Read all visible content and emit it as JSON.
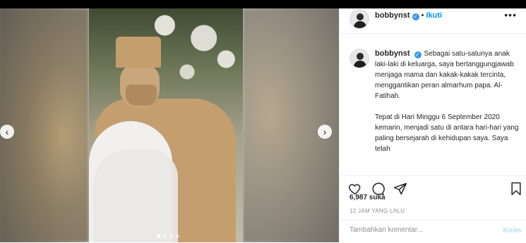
{
  "media": {
    "slide_count": 4,
    "active_slide": 1,
    "prev_icon": "chevron-left-icon",
    "next_icon": "chevron-right-icon"
  },
  "header": {
    "username": "bobbynst",
    "separator": "•",
    "follow_label": "Ikuti",
    "more_icon": "more-options-icon"
  },
  "caption": {
    "username": "bobbynst",
    "paragraph1": "Sebagai satu-satunya anak laki-laki di keluarga, saya bertanggungjawab menjaga mama dan kakak-kakak tercinta, menggantikan peran almarhum papa. Al-Fatihah.",
    "paragraph2": "Tepat di Hari Minggu 6 September 2020 kemarin, menjadi satu di antara hari-hari yang paling bersejarah di kehidupan saya. Saya telah"
  },
  "actions": {
    "like_icon": "heart-icon",
    "comment_icon": "comment-icon",
    "share_icon": "share-icon",
    "save_icon": "bookmark-icon"
  },
  "likes": "6,987 suka",
  "timestamp": "12 JAM YANG LALU",
  "comment": {
    "placeholder": "Tambahkan komentar...",
    "post_label": "Kirim"
  },
  "colors": {
    "verified": "#3897f0",
    "follow": "#0095f6",
    "post_disabled": "#b2dffc"
  }
}
